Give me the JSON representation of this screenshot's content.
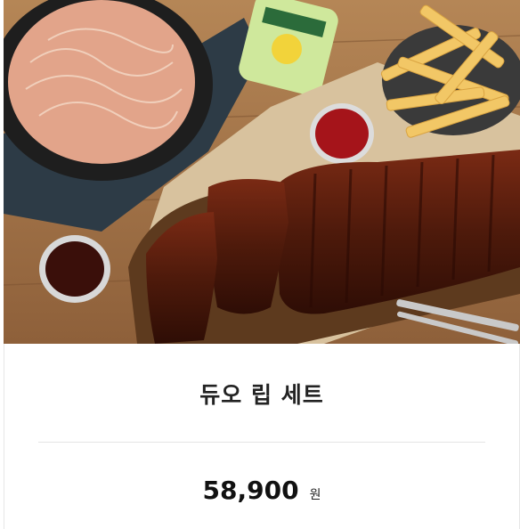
{
  "product": {
    "image_alt": "",
    "name": "듀오 립 세트",
    "price": "58,900",
    "currency_unit": "원"
  },
  "colors": {
    "wood": "#a97a4f",
    "ribs": "#5a1f10",
    "sauce": "#7a0f0f",
    "text_primary": "#222222"
  }
}
